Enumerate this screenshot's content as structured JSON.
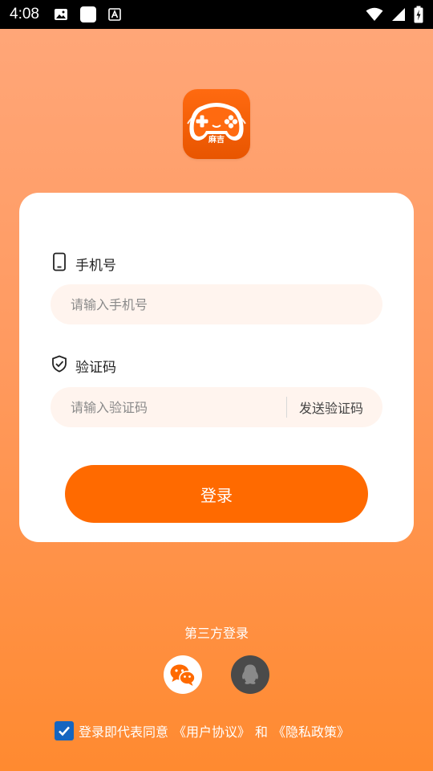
{
  "status_bar": {
    "time": "4:08",
    "icons_left": [
      "image-icon",
      "white-square-icon",
      "a-text-icon"
    ],
    "icons_right": [
      "wifi-icon",
      "signal-icon",
      "battery-icon"
    ]
  },
  "logo": {
    "text": "麻吉",
    "icon": "gamepad-icon",
    "color": "#ff6a10"
  },
  "phone_field": {
    "label": "手机号",
    "icon": "phone-icon",
    "placeholder": "请输入手机号",
    "value": ""
  },
  "code_field": {
    "label": "验证码",
    "icon": "shield-check-icon",
    "placeholder": "请输入验证码",
    "value": "",
    "send_label": "发送验证码"
  },
  "login_button": {
    "label": "登录",
    "color": "#ff6a00"
  },
  "third_party": {
    "title": "第三方登录",
    "providers": [
      {
        "name": "wechat",
        "icon": "wechat-icon",
        "color": "#ff6a00"
      },
      {
        "name": "qq",
        "icon": "qq-icon",
        "color": "#4a4a4a"
      }
    ]
  },
  "agreement": {
    "checked": true,
    "prefix": "登录即代表同意",
    "user_agreement": "《用户协议》",
    "conjunction": "和",
    "privacy_policy": "《隐私政策》"
  },
  "colors": {
    "accent": "#ff6a00",
    "background_top": "#ffa77a",
    "background_bottom": "#ff8a30",
    "input_bg": "#fff4ee"
  }
}
